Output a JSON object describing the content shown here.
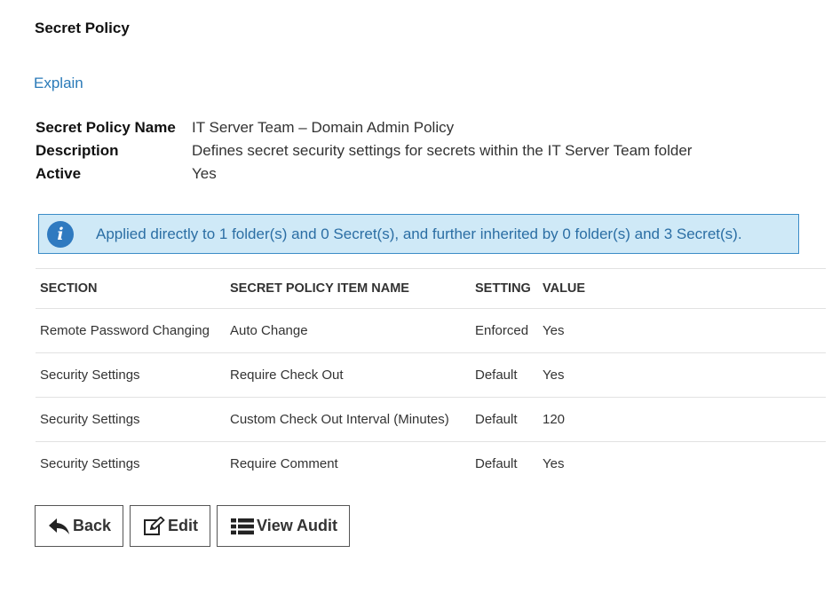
{
  "page_title": "Secret Policy",
  "explain_link": "Explain",
  "properties": [
    {
      "label": "Secret Policy Name",
      "value": "IT Server Team – Domain Admin Policy"
    },
    {
      "label": "Description",
      "value": "Defines secret security settings for secrets within the IT Server Team folder"
    },
    {
      "label": "Active",
      "value": "Yes"
    }
  ],
  "info_banner": {
    "icon": "info-icon",
    "text": "Applied directly to 1 folder(s) and 0 Secret(s), and further inherited by 0 folder(s) and 3 Secret(s)."
  },
  "table": {
    "headers": [
      "SECTION",
      "SECRET POLICY ITEM NAME",
      "SETTING",
      "VALUE"
    ],
    "rows": [
      [
        "Remote Password Changing",
        "Auto Change",
        "Enforced",
        "Yes"
      ],
      [
        "Security Settings",
        "Require Check Out",
        "Default",
        "Yes"
      ],
      [
        "Security Settings",
        "Custom Check Out Interval (Minutes)",
        "Default",
        "120"
      ],
      [
        "Security Settings",
        "Require Comment",
        "Default",
        "Yes"
      ]
    ]
  },
  "buttons": {
    "back": {
      "label": "Back",
      "icon": "reply-arrow-icon"
    },
    "edit": {
      "label": "Edit",
      "icon": "edit-icon"
    },
    "view_audit": {
      "label": "View Audit",
      "icon": "list-icon"
    }
  },
  "colors": {
    "link": "#2a7ab8",
    "banner_bg": "#cfe9f7",
    "banner_border": "#3b8cc7",
    "info_icon": "#2f7ac0"
  }
}
